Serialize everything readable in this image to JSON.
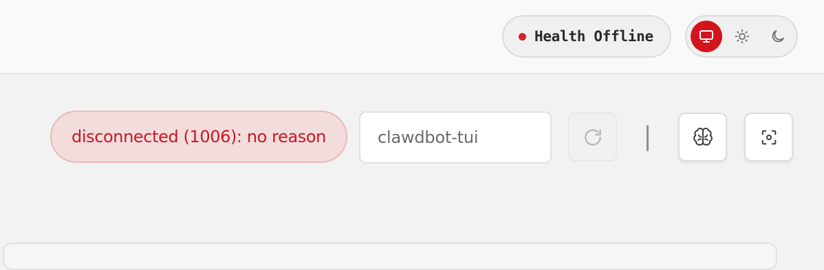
{
  "header": {
    "health": {
      "label": "Health Offline",
      "status_color": "#d4212b"
    },
    "theme_switcher": {
      "options": [
        {
          "name": "system",
          "icon": "monitor-icon",
          "active": true
        },
        {
          "name": "light",
          "icon": "sun-icon",
          "active": false
        },
        {
          "name": "dark",
          "icon": "moon-icon",
          "active": false
        }
      ],
      "accent": "#d3141d"
    }
  },
  "toolbar": {
    "connection_error": "disconnected (1006): no reason",
    "session_input": {
      "value": "clawdbot-tui"
    },
    "refresh_icon": "refresh-icon",
    "brain_icon": "brain-icon",
    "focus_icon": "focus-icon"
  }
}
